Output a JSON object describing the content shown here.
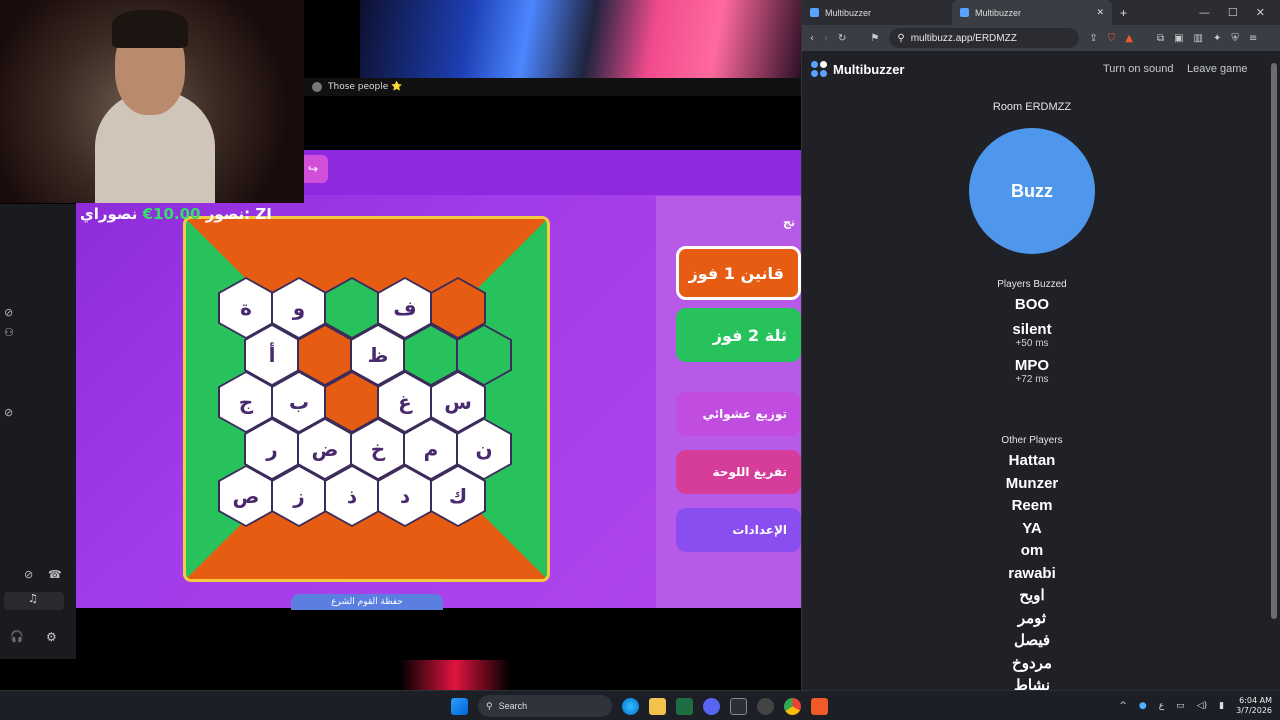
{
  "stream": {
    "discord_channel": "Those people ⭐",
    "score_overlay": {
      "prefix": "نصور",
      "value": "10.00€",
      "label": "نصوراي:",
      "tag": "ZI"
    }
  },
  "game": {
    "rows": [
      [
        "ة",
        "و",
        "",
        "ف",
        ""
      ],
      [
        "أ",
        "",
        "ظ",
        "",
        ""
      ],
      [
        "ج",
        "ب",
        "",
        "غ",
        "س"
      ],
      [
        "ر",
        "ض",
        "خ",
        "م",
        "ن"
      ],
      [
        "ص",
        "ز",
        "ذ",
        "د",
        "ك"
      ]
    ],
    "team1": "قانين 1 فوز",
    "team2": "ثلة 2 فوز",
    "random_btn": "توزيع عشوائي",
    "clear_btn": "تفريغ اللوحة",
    "settings_btn": "الإعدادات",
    "bottom_tab": "حفظة القوم الشرع",
    "side_heading": "تج"
  },
  "browser": {
    "tabs": [
      {
        "label": "Multibuzzer"
      },
      {
        "label": "Multibuzzer"
      }
    ],
    "url": "multibuzz.app/ERDMZZ",
    "new_tab": "+",
    "win_min": "—",
    "win_max": "☐",
    "win_close": "✕",
    "tab_close": "✕"
  },
  "app": {
    "brand": "Multibuzzer",
    "turn_on_sound": "Turn on sound",
    "leave_game": "Leave game",
    "room": "Room ERDMZZ",
    "buzz": "Buzz",
    "players_buzzed_title": "Players Buzzed",
    "buzzed": [
      {
        "name": "BOO",
        "delay": ""
      },
      {
        "name": "silent",
        "delay": "+50 ms"
      },
      {
        "name": "MPO",
        "delay": "+72 ms"
      }
    ],
    "other_players_title": "Other Players",
    "others": [
      "Hattan",
      "Munzer",
      "Reem",
      "YA",
      "om",
      "rawabi",
      "اويح",
      "ثومر",
      "فيصل",
      "مردوخ",
      "نشاط"
    ],
    "logo_colors": [
      "#5aa2ff",
      "#ffffff",
      "#5aa2ff",
      "#5aa2ff"
    ]
  },
  "taskbar": {
    "search": "Search",
    "time": "6:04 AM",
    "date": "3/7/2026",
    "lang": "ع"
  },
  "colors": {
    "buzz": "#4f97ec",
    "orange": "#e65c13",
    "green": "#27c25c",
    "purple": "#a23bea"
  }
}
